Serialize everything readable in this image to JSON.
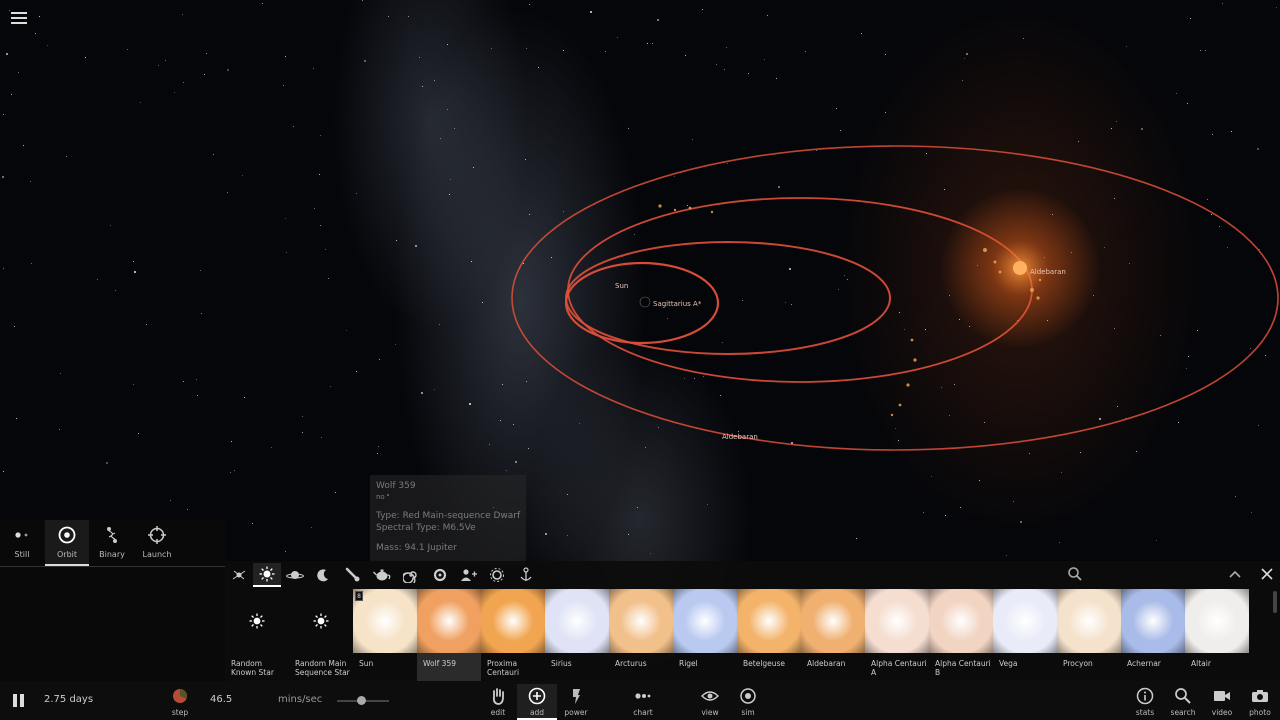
{
  "scene": {
    "labels": {
      "sun": "Sun",
      "sagittarius": "Sagittarius A*",
      "aldebaran_top": "Aldebaran",
      "aldebaran_bottom": "Aldebaran"
    },
    "orbit_color": "#e0503a"
  },
  "tooltip": {
    "name": "Wolf 359",
    "line2": "no",
    "type": "Type: Red Main-sequence Dwarf",
    "spectral": "Spectral Type: M6.5Ve",
    "mass": "Mass: 94.1 Jupiter"
  },
  "modes": [
    {
      "label": "Still",
      "icon": "still-icon"
    },
    {
      "label": "Orbit",
      "icon": "orbit-icon"
    },
    {
      "label": "Binary",
      "icon": "binary-icon"
    },
    {
      "label": "Launch",
      "icon": "launch-icon"
    }
  ],
  "categories": [
    "galaxy-icon",
    "star-icon",
    "planet-icon",
    "moon-icon",
    "comet-icon",
    "teapot-icon",
    "spiral-icon",
    "ring-icon",
    "people-icon",
    "settings-icon",
    "anchor-icon"
  ],
  "items": [
    {
      "label": "Random Known Star",
      "kind": "icon"
    },
    {
      "label": "Random Main Sequence Star",
      "kind": "icon"
    },
    {
      "label": "Sun",
      "color": "#f6e3c8",
      "badge": "8"
    },
    {
      "label": "Wolf 359",
      "color": "#f0a060"
    },
    {
      "label": "Proxima Centauri",
      "color": "#f2a550"
    },
    {
      "label": "Sirius",
      "color": "#dfe3f5"
    },
    {
      "label": "Arcturus",
      "color": "#f2c08a"
    },
    {
      "label": "Rigel",
      "color": "#b9c9f0"
    },
    {
      "label": "Betelgeuse",
      "color": "#f3b36a"
    },
    {
      "label": "Aldebaran",
      "color": "#f0b070"
    },
    {
      "label": "Alpha Centauri A",
      "color": "#f5ddd0"
    },
    {
      "label": "Alpha Centauri B",
      "color": "#f2d4c2"
    },
    {
      "label": "Vega",
      "color": "#e9ecf8"
    },
    {
      "label": "Procyon",
      "color": "#f5e2cc"
    },
    {
      "label": "Achernar",
      "color": "#a9bbe8"
    },
    {
      "label": "Altair",
      "color": "#f0eeec"
    }
  ],
  "toolbar": {
    "time": "2.75 days",
    "step_label": "step",
    "speed_value": "46.5",
    "speed_unit": "mins/sec",
    "edit": "edit",
    "add": "add",
    "power": "power",
    "chart": "chart",
    "view": "view",
    "sim": "sim",
    "stats": "stats",
    "search": "search",
    "video": "video",
    "photo": "photo"
  }
}
